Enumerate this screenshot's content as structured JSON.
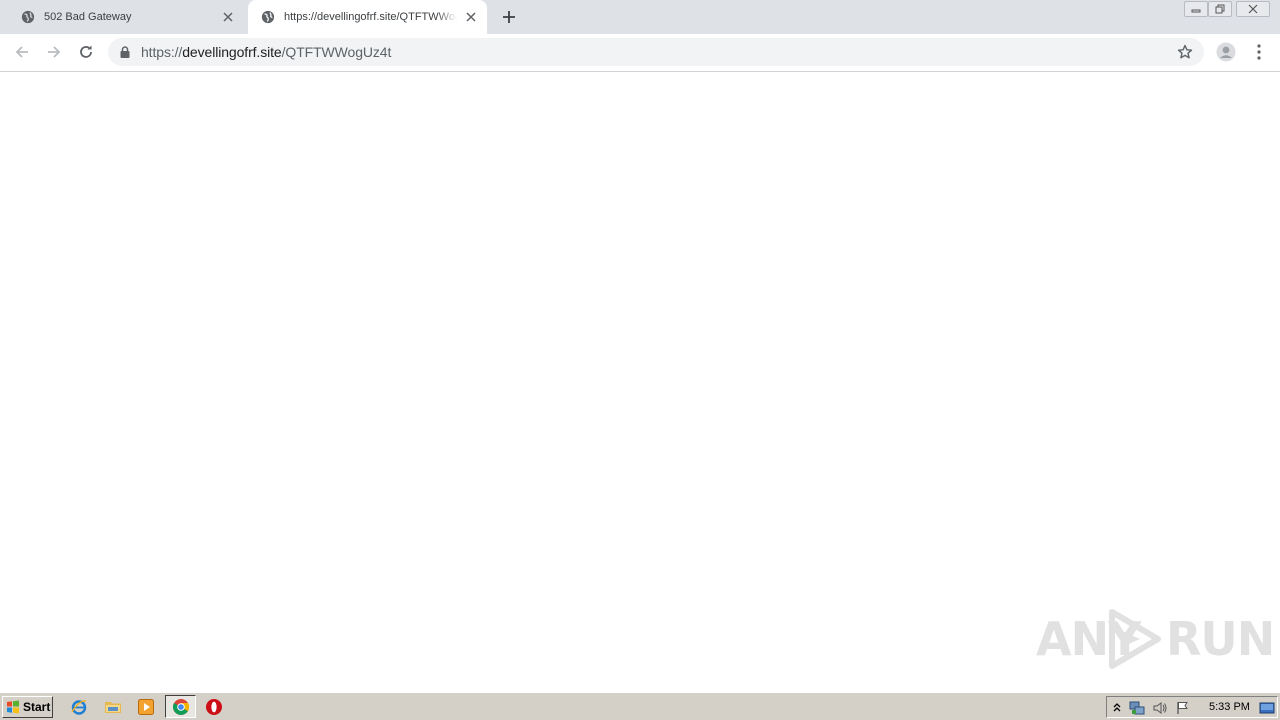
{
  "browser": {
    "tabs": [
      {
        "title": "502 Bad Gateway",
        "active": false
      },
      {
        "title": "https://devellingofrf.site/QTFTWWogUz4t",
        "active": true
      }
    ],
    "omnibox": {
      "scheme": "https://",
      "host": "devellingofrf.site",
      "path": "/QTFTWWogUz4t"
    }
  },
  "watermark": {
    "left": "ANY",
    "right": "RUN"
  },
  "taskbar": {
    "start_label": "Start",
    "clock": "5:33 PM",
    "pinned": [
      "internet-explorer",
      "file-explorer",
      "media-player",
      "chrome",
      "opera"
    ]
  }
}
